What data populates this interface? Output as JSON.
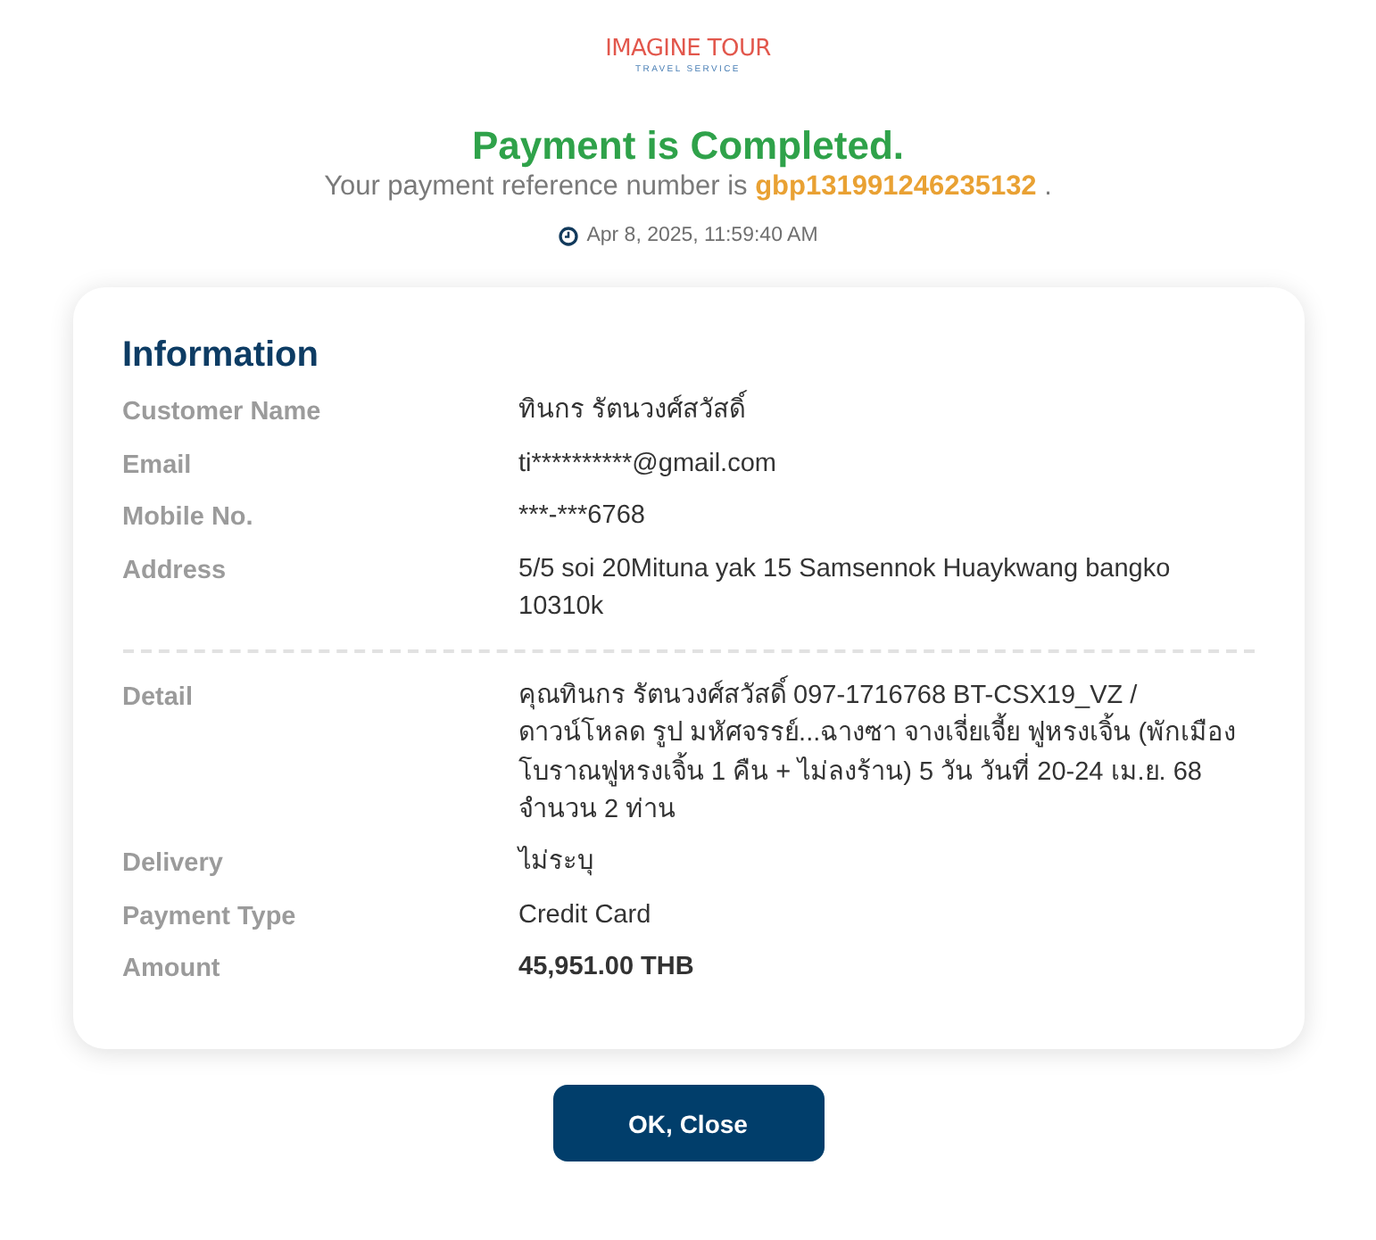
{
  "logo": {
    "name": "IMAGINE TOUR",
    "tagline": "TRAVEL SERVICE"
  },
  "header": {
    "title": "Payment is Completed.",
    "reference": "Your payment reference number is **gbp131991246235132** .",
    "timestamp": "Apr 8, 2025, 11:59:40 AM"
  },
  "information": {
    "title": "Information",
    "sections": [
      {
        "rows": [
          {
            "label": "Customer Name",
            "value": "ทินกร รัตนวงศ์สวัสดิ์",
            "kind": "text"
          },
          {
            "label": "Email",
            "value": "ti**********@gmail.com",
            "kind": "text"
          },
          {
            "label": "Mobile No.",
            "value": "***-***6768",
            "kind": "text"
          },
          {
            "label": "Address",
            "value": "5/5 soi 20Mituna yak 15 Samsennok Huaykwang bangko 10310k",
            "kind": "text"
          }
        ]
      },
      {
        "rows": [
          {
            "label": "Detail",
            "value": "คุณทินกร รัตนวงศ์สวัสดิ์ 097-1716768 BT-CSX19_VZ / ดาวน์โหลด รูป มหัศจรรย์...ฉางซา จางเจี่ยเจี้ย ฟูหรงเจิ้น (พักเมืองโบราณฟูหรงเจิ้น 1 คืน + ไม่ลงร้าน) 5 วัน วันที่ 20-24 เม.ย. 68 จำนวน 2 ท่าน",
            "kind": "text"
          },
          {
            "label": "Delivery",
            "value": "ไม่ระบุ",
            "kind": "text"
          },
          {
            "label": "Payment Type",
            "value": "Credit Card",
            "kind": "text"
          },
          {
            "label": "Amount",
            "value": "45,951.00 THB",
            "kind": "amount"
          }
        ]
      }
    ]
  },
  "buttons": [
    {
      "label": "OK, Close"
    }
  ]
}
